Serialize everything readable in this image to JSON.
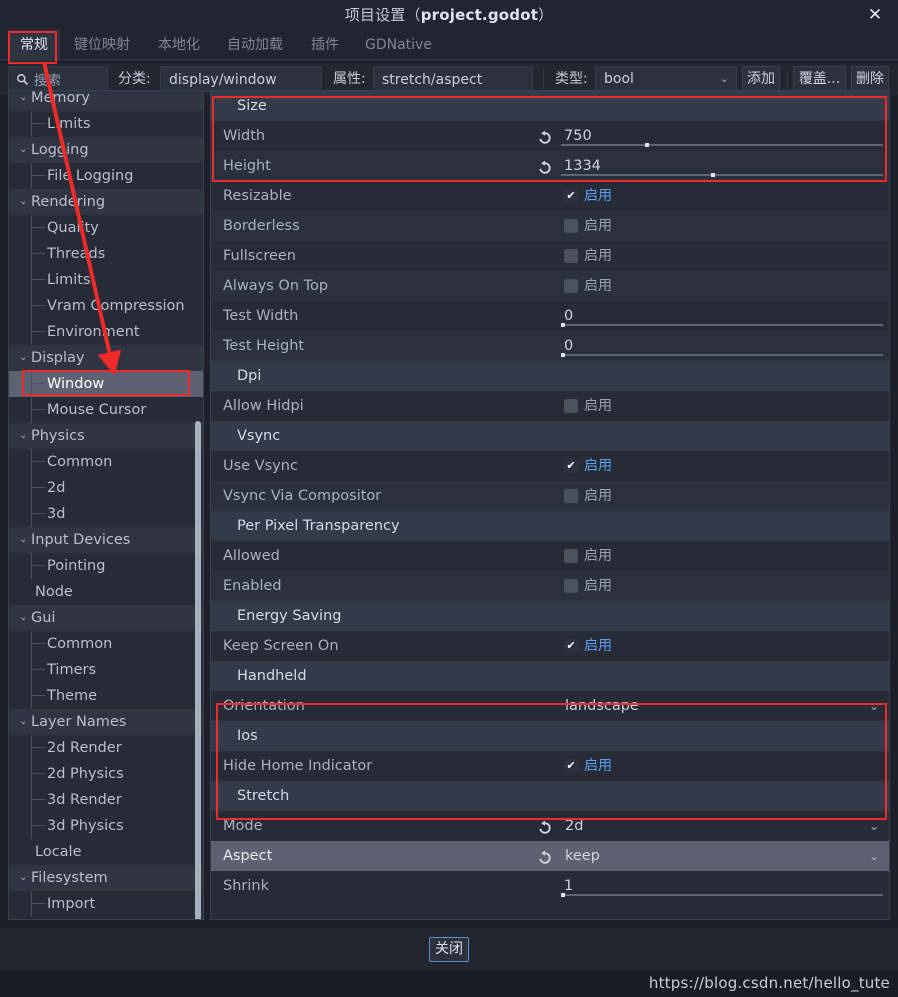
{
  "window": {
    "title_prefix": "项目设置（",
    "title_file": "project.godot",
    "title_suffix": "）",
    "close_icon": "✕"
  },
  "tabs": [
    {
      "label": "常规",
      "active": true
    },
    {
      "label": "键位映射",
      "active": false
    },
    {
      "label": "本地化",
      "active": false
    },
    {
      "label": "自动加载",
      "active": false
    },
    {
      "label": "插件",
      "active": false
    },
    {
      "label": "GDNative",
      "active": false
    }
  ],
  "toolbar": {
    "search_placeholder": "搜索",
    "search_icon": "search-icon",
    "category_label": "分类:",
    "category_value": "display/window",
    "property_label": "属性:",
    "property_value": "stretch/aspect",
    "type_label": "类型:",
    "type_value": "bool",
    "add_button": "添加",
    "override_button": "覆盖...",
    "delete_button": "删除"
  },
  "sidebar": {
    "items": [
      {
        "label": "Memory",
        "kind": "parent",
        "selected": false
      },
      {
        "label": "Limits",
        "kind": "child",
        "selected": false
      },
      {
        "label": "Logging",
        "kind": "parent",
        "selected": false
      },
      {
        "label": "File Logging",
        "kind": "child",
        "selected": false
      },
      {
        "label": "Rendering",
        "kind": "parent",
        "selected": false
      },
      {
        "label": "Quality",
        "kind": "child",
        "selected": false
      },
      {
        "label": "Threads",
        "kind": "child",
        "selected": false
      },
      {
        "label": "Limits",
        "kind": "child",
        "selected": false
      },
      {
        "label": "Vram Compression",
        "kind": "child",
        "selected": false
      },
      {
        "label": "Environment",
        "kind": "child",
        "selected": false
      },
      {
        "label": "Display",
        "kind": "parent",
        "selected": false
      },
      {
        "label": "Window",
        "kind": "child",
        "selected": true
      },
      {
        "label": "Mouse Cursor",
        "kind": "child",
        "selected": false
      },
      {
        "label": "Physics",
        "kind": "parent",
        "selected": false
      },
      {
        "label": "Common",
        "kind": "child",
        "selected": false
      },
      {
        "label": "2d",
        "kind": "child",
        "selected": false
      },
      {
        "label": "3d",
        "kind": "child",
        "selected": false
      },
      {
        "label": "Input Devices",
        "kind": "parent",
        "selected": false
      },
      {
        "label": "Pointing",
        "kind": "child",
        "selected": false
      },
      {
        "label": "Node",
        "kind": "plain",
        "selected": false
      },
      {
        "label": "Gui",
        "kind": "parent",
        "selected": false
      },
      {
        "label": "Common",
        "kind": "child",
        "selected": false
      },
      {
        "label": "Timers",
        "kind": "child",
        "selected": false
      },
      {
        "label": "Theme",
        "kind": "child",
        "selected": false
      },
      {
        "label": "Layer Names",
        "kind": "parent",
        "selected": false
      },
      {
        "label": "2d Render",
        "kind": "child",
        "selected": false
      },
      {
        "label": "2d Physics",
        "kind": "child",
        "selected": false
      },
      {
        "label": "3d Render",
        "kind": "child",
        "selected": false
      },
      {
        "label": "3d Physics",
        "kind": "child",
        "selected": false
      },
      {
        "label": "Locale",
        "kind": "plain",
        "selected": false
      },
      {
        "label": "Filesystem",
        "kind": "parent",
        "selected": false
      },
      {
        "label": "Import",
        "kind": "child",
        "selected": false
      }
    ]
  },
  "properties": {
    "enabled_text": "启用",
    "rows": [
      {
        "type": "section",
        "label": "Size"
      },
      {
        "type": "number",
        "label": "Width",
        "value": "750",
        "reset": true,
        "grab": 84
      },
      {
        "type": "number",
        "label": "Height",
        "value": "1334",
        "reset": true,
        "grab": 150,
        "alt": true
      },
      {
        "type": "checkbox",
        "label": "Resizable",
        "checked": true
      },
      {
        "type": "checkbox",
        "label": "Borderless",
        "checked": false,
        "alt": true
      },
      {
        "type": "checkbox",
        "label": "Fullscreen",
        "checked": false
      },
      {
        "type": "checkbox",
        "label": "Always On Top",
        "checked": false,
        "alt": true
      },
      {
        "type": "number",
        "label": "Test Width",
        "value": "0",
        "reset": false,
        "grab": 0
      },
      {
        "type": "number",
        "label": "Test Height",
        "value": "0",
        "reset": false,
        "grab": 0,
        "alt": true
      },
      {
        "type": "section",
        "label": "Dpi"
      },
      {
        "type": "checkbox",
        "label": "Allow Hidpi",
        "checked": false
      },
      {
        "type": "section",
        "label": "Vsync"
      },
      {
        "type": "checkbox",
        "label": "Use Vsync",
        "checked": true
      },
      {
        "type": "checkbox",
        "label": "Vsync Via Compositor",
        "checked": false,
        "alt": true
      },
      {
        "type": "section",
        "label": "Per Pixel Transparency"
      },
      {
        "type": "checkbox",
        "label": "Allowed",
        "checked": false
      },
      {
        "type": "checkbox",
        "label": "Enabled",
        "checked": false,
        "alt": true
      },
      {
        "type": "section",
        "label": "Energy Saving"
      },
      {
        "type": "checkbox",
        "label": "Keep Screen On",
        "checked": true
      },
      {
        "type": "section",
        "label": "Handheld"
      },
      {
        "type": "dropdown",
        "label": "Orientation",
        "value": "landscape",
        "reset": false
      },
      {
        "type": "section",
        "label": "Ios"
      },
      {
        "type": "checkbox",
        "label": "Hide Home Indicator",
        "checked": true
      },
      {
        "type": "section",
        "label": "Stretch"
      },
      {
        "type": "dropdown",
        "label": "Mode",
        "value": "2d",
        "reset": true
      },
      {
        "type": "dropdown",
        "label": "Aspect",
        "value": "keep",
        "reset": true,
        "highlight": true
      },
      {
        "type": "number",
        "label": "Shrink",
        "value": "1",
        "reset": false,
        "grab": 0
      }
    ]
  },
  "footer": {
    "close_label": "关闭"
  },
  "watermark": {
    "text": "https://blog.csdn.net/hello_tute"
  },
  "colors": {
    "window_bg": "#1d2029",
    "panel_bg": "#262b36",
    "section_bg": "#333a49",
    "selected_bg": "#5c6272",
    "accent_blue": "#5a9ff2",
    "annotation_red": "#ee2a2a",
    "focus_border": "#5b8fd6"
  }
}
